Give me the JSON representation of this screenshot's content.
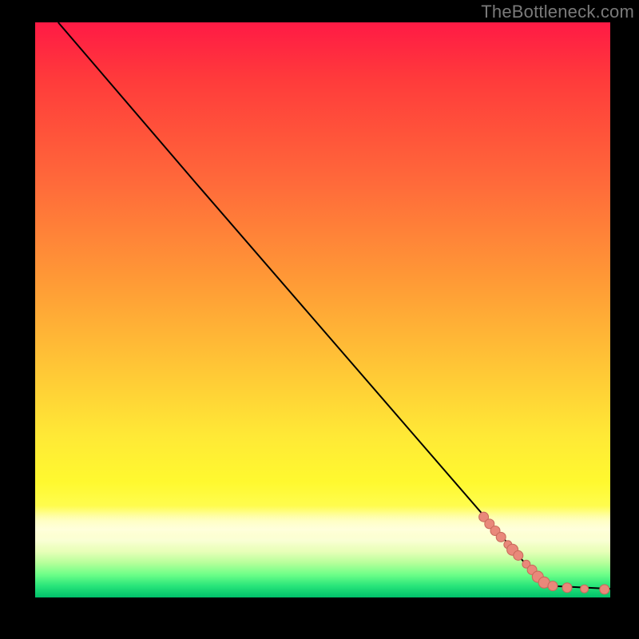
{
  "watermark": "TheBottleneck.com",
  "colors": {
    "curve_stroke": "#000000",
    "marker_fill": "#e9887a",
    "marker_stroke": "#c96a5c",
    "background": "#000000"
  },
  "chart_data": {
    "type": "line",
    "title": "",
    "xlabel": "",
    "ylabel": "",
    "xlim": [
      0,
      100
    ],
    "ylim": [
      0,
      100
    ],
    "grid": false,
    "legend": false,
    "curve": [
      {
        "x": 4,
        "y": 100
      },
      {
        "x": 28,
        "y": 72
      },
      {
        "x": 86,
        "y": 5
      },
      {
        "x": 90,
        "y": 2
      },
      {
        "x": 100,
        "y": 1.5
      }
    ],
    "markers": [
      {
        "x": 78.0,
        "y": 14.0,
        "r": 6
      },
      {
        "x": 79.0,
        "y": 12.8,
        "r": 6
      },
      {
        "x": 80.0,
        "y": 11.6,
        "r": 6
      },
      {
        "x": 81.0,
        "y": 10.5,
        "r": 6
      },
      {
        "x": 82.2,
        "y": 9.2,
        "r": 5
      },
      {
        "x": 83.0,
        "y": 8.3,
        "r": 7
      },
      {
        "x": 84.0,
        "y": 7.3,
        "r": 6
      },
      {
        "x": 85.4,
        "y": 5.8,
        "r": 5
      },
      {
        "x": 86.4,
        "y": 4.8,
        "r": 6
      },
      {
        "x": 87.4,
        "y": 3.6,
        "r": 7
      },
      {
        "x": 88.5,
        "y": 2.6,
        "r": 7
      },
      {
        "x": 90.0,
        "y": 2.0,
        "r": 6
      },
      {
        "x": 92.5,
        "y": 1.7,
        "r": 6
      },
      {
        "x": 95.5,
        "y": 1.5,
        "r": 5
      },
      {
        "x": 99.0,
        "y": 1.4,
        "r": 6
      }
    ]
  }
}
